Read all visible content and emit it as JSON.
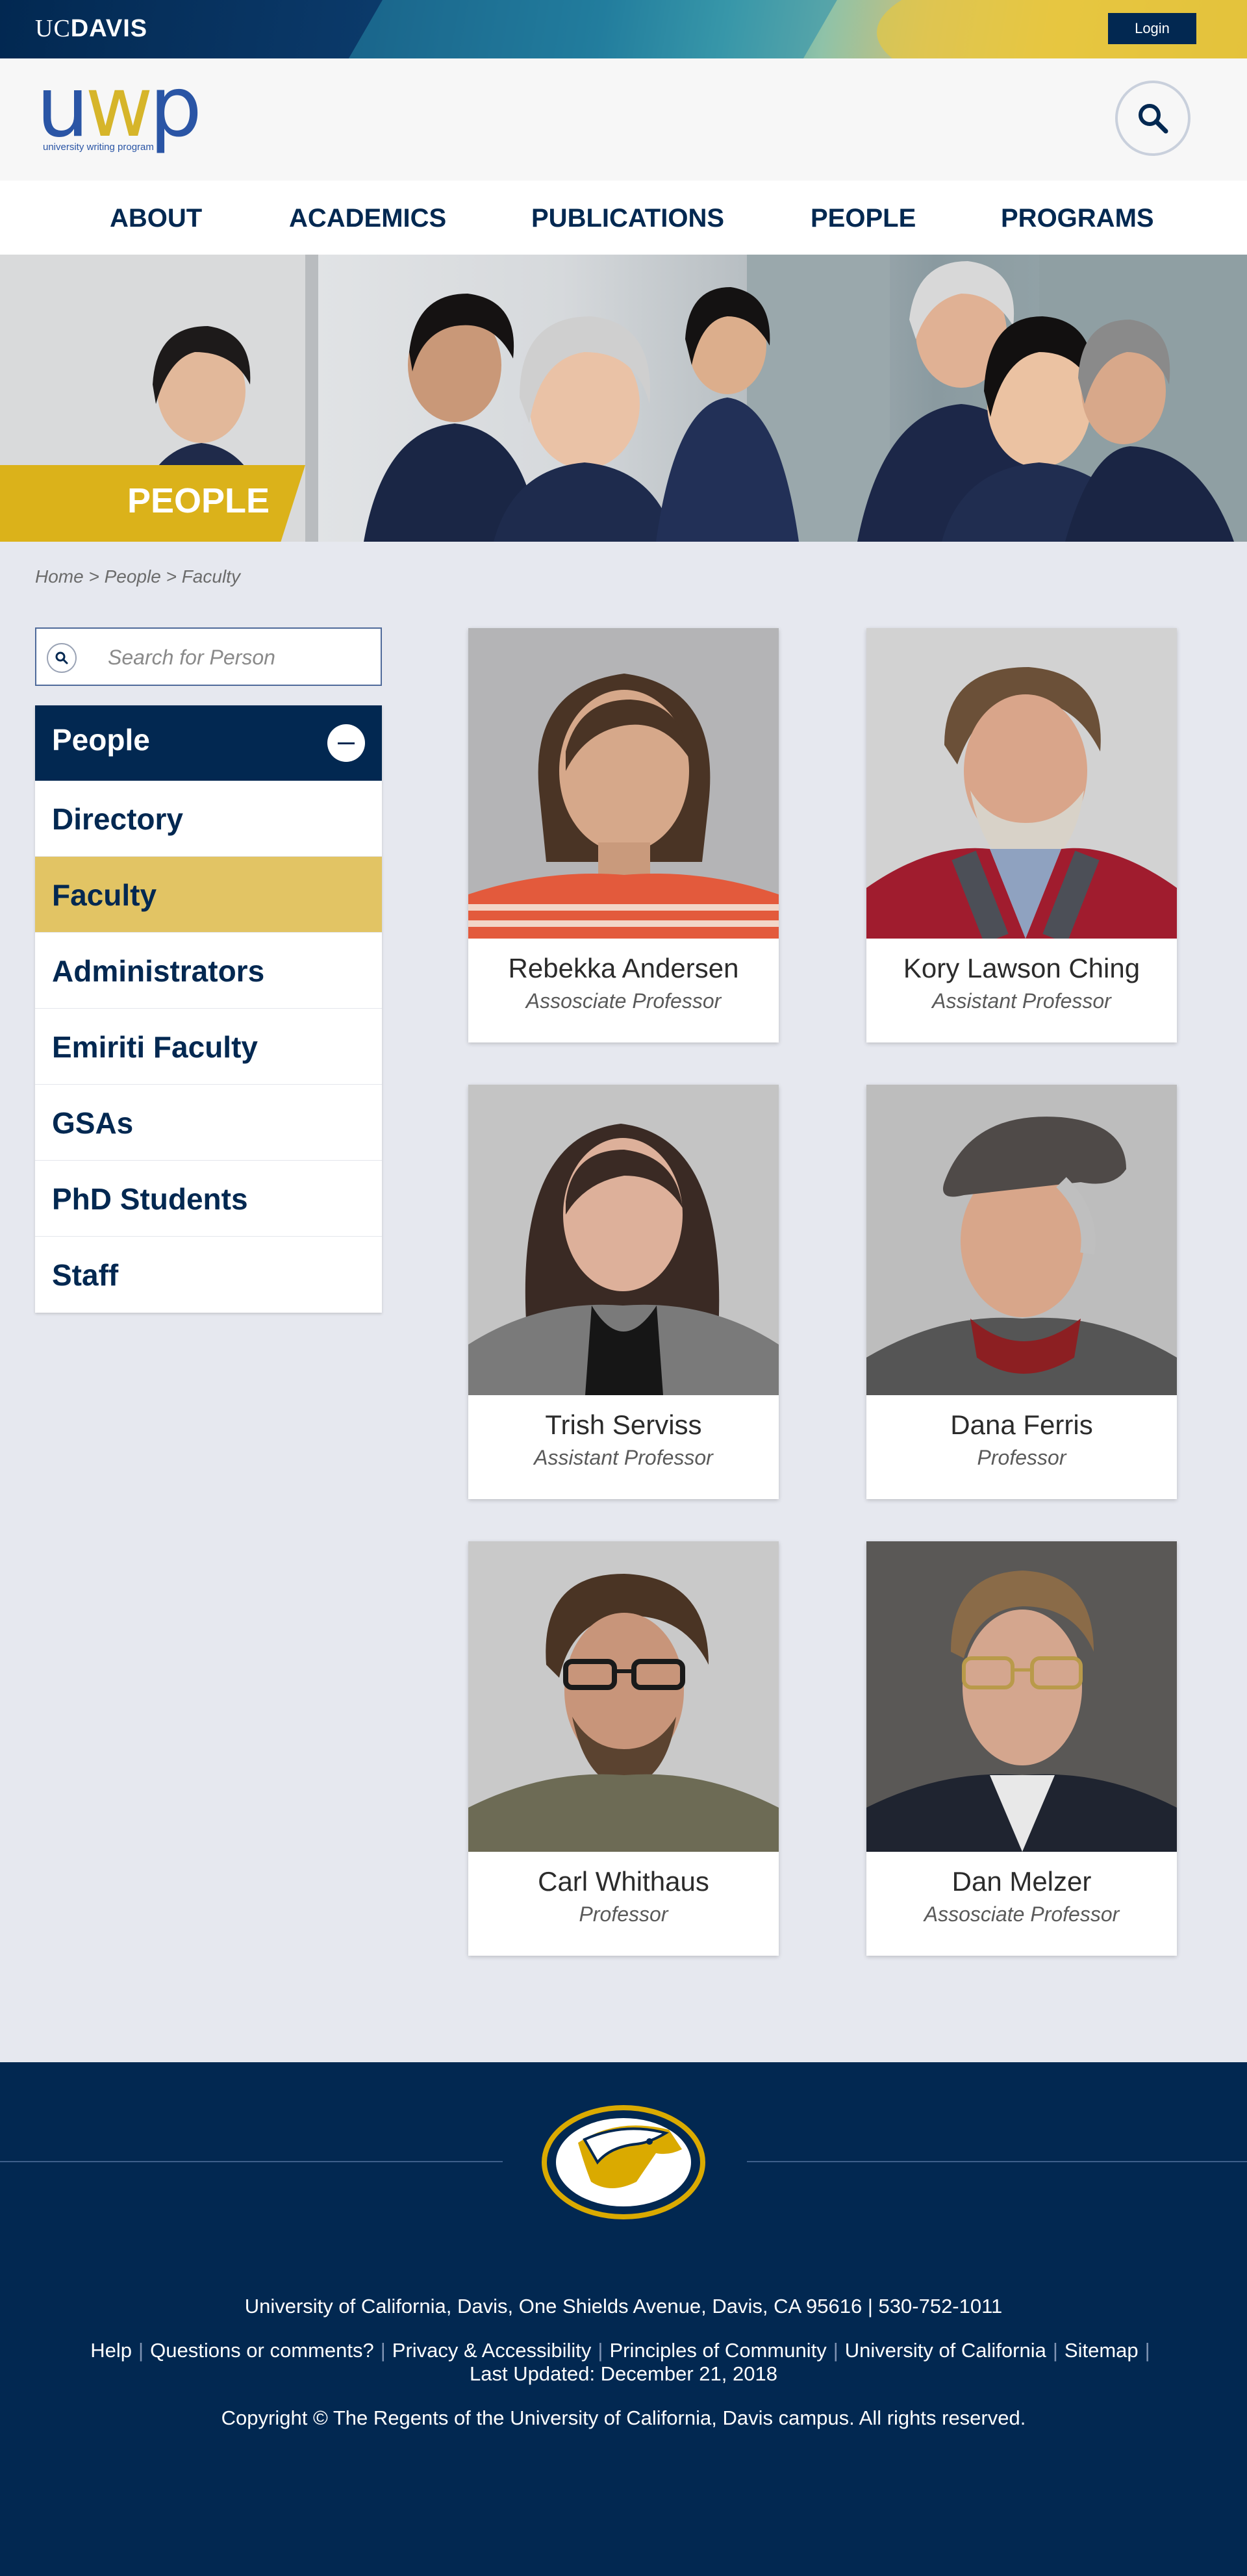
{
  "topbar": {
    "brand_uc": "UC",
    "brand_davis": "DAVIS",
    "login_label": "Login"
  },
  "header": {
    "logo_u": "u",
    "logo_w": "w",
    "logo_p": "p",
    "logo_tagline": "university writing program",
    "search_icon": "search-icon"
  },
  "nav": {
    "items": [
      {
        "label": "ABOUT"
      },
      {
        "label": "ACADEMICS"
      },
      {
        "label": "PUBLICATIONS"
      },
      {
        "label": "PEOPLE"
      },
      {
        "label": "PROGRAMS"
      }
    ]
  },
  "hero": {
    "title": "PEOPLE"
  },
  "breadcrumb": {
    "text": "Home > People > Faculty"
  },
  "sidebar": {
    "search_placeholder": "Search for Person",
    "section_title": "People",
    "items": [
      {
        "label": "Directory"
      },
      {
        "label": "Faculty"
      },
      {
        "label": "Administrators"
      },
      {
        "label": "Emiriti Faculty"
      },
      {
        "label": "GSAs"
      },
      {
        "label": "PhD Students"
      },
      {
        "label": "Staff"
      }
    ],
    "active_item": "Faculty"
  },
  "people": [
    {
      "name": "Rebekka Andersen",
      "title": "Assosciate Professor"
    },
    {
      "name": "Kory Lawson Ching",
      "title": "Assistant Professor"
    },
    {
      "name": "Trish Serviss",
      "title": "Assistant Professor"
    },
    {
      "name": "Dana Ferris",
      "title": "Professor"
    },
    {
      "name": "Carl Whithaus",
      "title": "Professor"
    },
    {
      "name": "Dan Melzer",
      "title": "Assosciate Professor"
    }
  ],
  "footer": {
    "address": "University of California, Davis, One Shields Avenue, Davis, CA 95616 | 530-752-1011",
    "links": [
      {
        "label": "Help"
      },
      {
        "label": "Questions or comments?"
      },
      {
        "label": "Privacy & Accessibility"
      },
      {
        "label": "Principles of Community"
      },
      {
        "label": "University of California"
      },
      {
        "label": "Sitemap"
      }
    ],
    "last_updated": "Last Updated: December 21, 2018",
    "copyright": "Copyright © The Regents of the University of California, Davis campus. All rights reserved."
  },
  "colors": {
    "navy": "#022851",
    "gold": "#DAAA00",
    "active_gold": "#E2C464",
    "background": "#E6E8EF"
  }
}
